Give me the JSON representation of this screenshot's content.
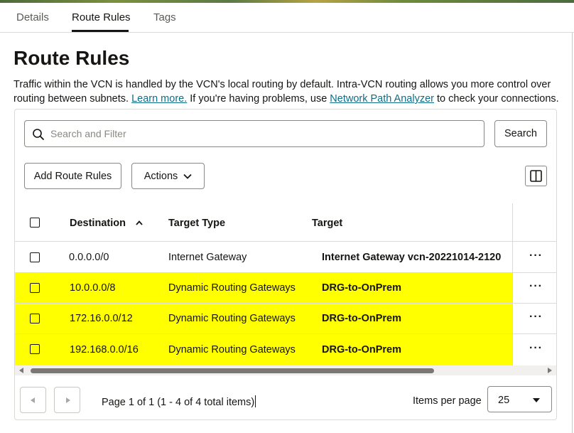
{
  "tabs": [
    {
      "label": "Details"
    },
    {
      "label": "Route Rules"
    },
    {
      "label": "Tags"
    }
  ],
  "page": {
    "title": "Route Rules",
    "description_1": "Traffic within the VCN is handled by the VCN's local routing by default. Intra-VCN routing allows you more control over routing between subnets. ",
    "learn_more": "Learn more.",
    "description_2": " If you're having problems, use ",
    "network_path_analyzer": "Network Path Analyzer",
    "description_3": " to check your connections."
  },
  "search": {
    "placeholder": "Search and Filter",
    "button": "Search"
  },
  "toolbar": {
    "add_button": "Add Route Rules",
    "actions_button": "Actions"
  },
  "table": {
    "columns": [
      "Destination",
      "Target Type",
      "Target"
    ],
    "rows": [
      {
        "destination": "0.0.0.0/0",
        "target_type": "Internet Gateway",
        "target": "Internet Gateway vcn-20221014-2120",
        "highlighted": false
      },
      {
        "destination": "10.0.0.0/8",
        "target_type": "Dynamic Routing Gateways",
        "target": "DRG-to-OnPrem",
        "highlighted": true
      },
      {
        "destination": "172.16.0.0/12",
        "target_type": "Dynamic Routing Gateways",
        "target": "DRG-to-OnPrem",
        "highlighted": true
      },
      {
        "destination": "192.168.0.0/16",
        "target_type": "Dynamic Routing Gateways",
        "target": "DRG-to-OnPrem",
        "highlighted": true
      }
    ],
    "row_menu": "···"
  },
  "pagination": {
    "summary": "Page 1 of 1 (1 - 4 of 4 total items)",
    "items_per_page_label": "Items per page",
    "items_per_page": "25"
  },
  "colors": {
    "highlight": "#ffff00",
    "link": "#0f6d87"
  }
}
